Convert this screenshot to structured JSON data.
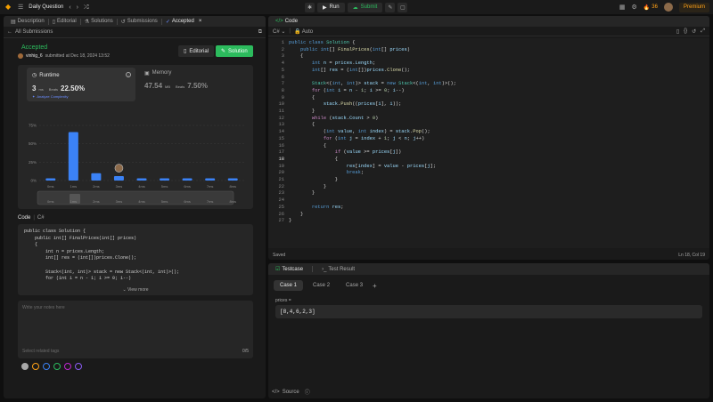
{
  "topbar": {
    "title": "Daily Question",
    "run_label": "Run",
    "submit_label": "Submit",
    "streak": "36",
    "premium_label": "Premium"
  },
  "left_tabs": [
    {
      "label": "Description",
      "icon": "description-icon"
    },
    {
      "label": "Editorial",
      "icon": "book-icon"
    },
    {
      "label": "Solutions",
      "icon": "flask-icon"
    },
    {
      "label": "Submissions",
      "icon": "history-icon"
    },
    {
      "label": "Accepted",
      "icon": "check-icon"
    }
  ],
  "submission": {
    "back_label": "All Submissions",
    "status": "Accepted",
    "user": "vinhig_6",
    "submitted_text": "submitted at Dec 18, 2024 13:52",
    "editorial_label": "Editorial",
    "solution_label": "Solution"
  },
  "runtime": {
    "title": "Runtime",
    "value": "3",
    "unit": "ms",
    "beats_label": "Beats",
    "beats_pct": "22.50%",
    "analyze_label": "Analyze Complexity"
  },
  "memory": {
    "title": "Memory",
    "value": "47.54",
    "unit": "MB",
    "beats_label": "Beats",
    "beats_pct": "7.50%"
  },
  "chart_data": {
    "type": "bar",
    "categories": [
      "0ms",
      "1ms",
      "2ms",
      "3ms",
      "4ms",
      "5ms",
      "6ms",
      "7ms",
      "8ms"
    ],
    "values": [
      3,
      66,
      10,
      6,
      3,
      3,
      3,
      3,
      3
    ],
    "yticks": [
      "75%",
      "50%",
      "25%",
      "0%"
    ],
    "ylim": [
      0,
      75
    ],
    "highlight_index": 3,
    "bar_color": "#3b82f6",
    "grid": true
  },
  "code_label": "Code",
  "code_lang": "C#",
  "code_preview": [
    "public class Solution {",
    "    public int[] FinalPrices(int[] prices)",
    "    {",
    "        int n = prices.Length;",
    "        int[] res = (int[])prices.Clone();",
    "",
    "        Stack<(int, int)> stack = new Stack<(int, int)>();",
    "        for (int i = n - 1; i >= 0; i--)"
  ],
  "view_more_label": "View more",
  "notes": {
    "placeholder": "Write your notes here",
    "tags_placeholder": "Select related tags",
    "count": "0/5"
  },
  "note_colors": [
    "#a8a8a8",
    "#ffa116",
    "#3b82f6",
    "#2cbb5d",
    "#c026d3",
    "#8b5cf6"
  ],
  "code_panel": {
    "title": "Code",
    "language": "C#",
    "auto_label": "Auto",
    "saved_label": "Saved",
    "cursor_pos": "Ln 18, Col 19"
  },
  "editor_lines": [
    "public class Solution {",
    "    public int[] FinalPrices(int[] prices)",
    "    {",
    "        int n = prices.Length;",
    "        int[] res = (int[])prices.Clone();",
    "",
    "        Stack<(int, int)> stack = new Stack<(int, int)>();",
    "        for (int i = n - 1; i >= 0; i--)",
    "        {",
    "            stack.Push((prices[i], i));",
    "        }",
    "        while (stack.Count > 0)",
    "        {",
    "            (int value, int index) = stack.Pop();",
    "            for (int j = index + 1; j < n; j++)",
    "            {",
    "                if (value >= prices[j])",
    "                {",
    "                    res[index] = value - prices[j];",
    "                    break;",
    "                }",
    "            }",
    "        }",
    "",
    "        return res;",
    "    }",
    "}"
  ],
  "test_panel": {
    "testcase_label": "Testcase",
    "result_label": "Test Result",
    "cases": [
      "Case 1",
      "Case 2",
      "Case 3"
    ],
    "input_label": "prices =",
    "input_value": "[8,4,6,2,3]",
    "source_label": "Source"
  }
}
